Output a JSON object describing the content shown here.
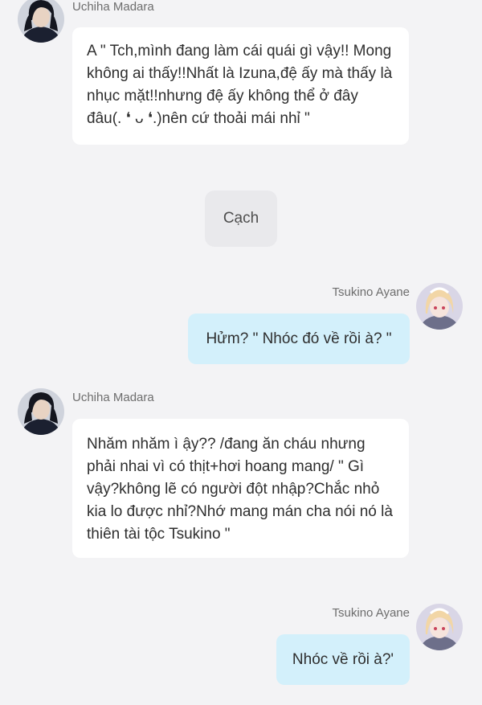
{
  "messages": [
    {
      "sender": "Uchiha Madara",
      "side": "left",
      "avatar_icon": "madara-avatar-icon",
      "text": "A \" Tch,mình đang làm cái quái gì vậy!! Mong không ai thấy!!Nhất là Izuna,đệ ấy mà thấy là nhục mặt!!nhưng đệ ấy không thể ở đây đâu(. ❛ ᴗ ❛.)nên cứ thoải mái nhỉ \""
    },
    {
      "type": "action",
      "text": "Cạch"
    },
    {
      "sender": "Tsukino Ayane",
      "side": "right",
      "avatar_icon": "ayane-avatar-icon",
      "text": "Hửm? \" Nhóc đó về rồi à? \""
    },
    {
      "sender": "Uchiha Madara",
      "side": "left",
      "avatar_icon": "madara-avatar-icon",
      "text": "Nhăm nhăm ì ậy?? /đang ăn cháu nhưng phải nhai vì có thịt+hơi hoang mang/ \" Gì vậy?không lẽ có người đột nhập?Chắc nhỏ kia lo được nhỉ?Nhớ mang mán cha nói nó là thiên tài tộc Tsukino \""
    },
    {
      "sender": "Tsukino Ayane",
      "side": "right",
      "avatar_icon": "ayane-avatar-icon",
      "text": "Nhóc về rồi à?'"
    }
  ],
  "colors": {
    "background": "#f3f3f5",
    "left_bubble": "#ffffff",
    "right_bubble": "#d3f0fb",
    "action_bubble": "#e9e9ec"
  }
}
